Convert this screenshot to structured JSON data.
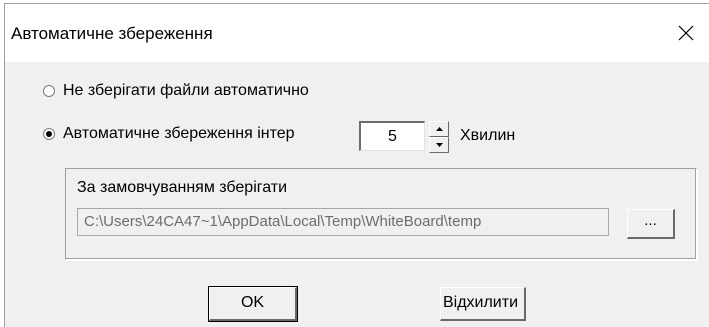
{
  "dialog": {
    "title": "Автоматичне збереження",
    "close_icon": "close-icon"
  },
  "options": {
    "no_autosave_label": "Не зберігати файли автоматично",
    "no_autosave_selected": false,
    "autosave_interval_label": "Автоматичне збереження інтер",
    "autosave_interval_selected": true,
    "interval_value": "5",
    "interval_unit": "Хвилин"
  },
  "save_location": {
    "group_label": "За замовчуванням зберігати",
    "path": "C:\\Users\\24CA47~1\\AppData\\Local\\Temp\\WhiteBoard\\temp",
    "browse_label": "..."
  },
  "buttons": {
    "ok_label": "OK",
    "cancel_label": "Відхилити"
  }
}
